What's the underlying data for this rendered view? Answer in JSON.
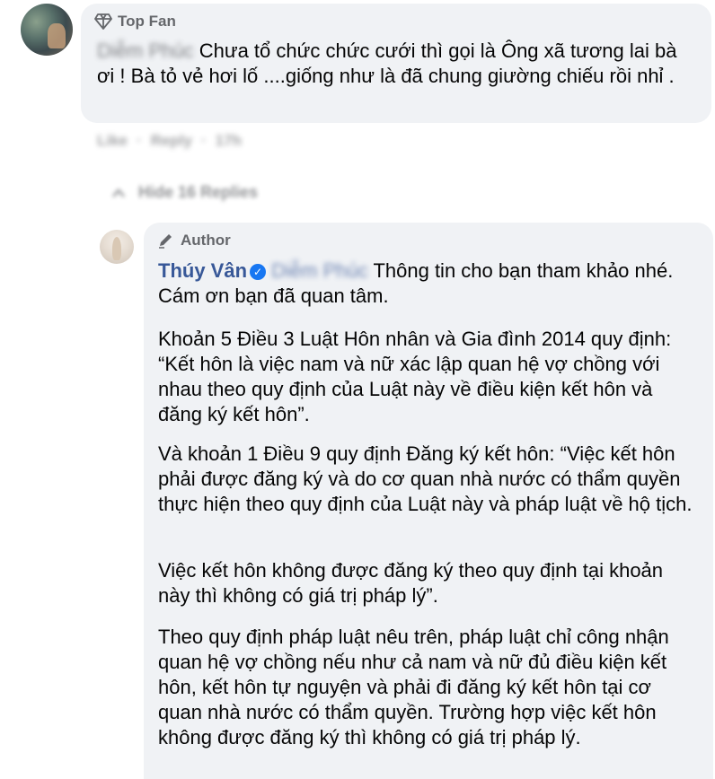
{
  "top_comment": {
    "badge": "Top Fan",
    "author_blurred": "Diễm Phúc",
    "text": "Chưa tổ chức chức cưới thì gọi là Ông xã tương lai bà ơi ! Bà tỏ vẻ hơi lố ....giống như là đã chung giường chiếu rồi nhỉ .",
    "actions": {
      "like": "Like",
      "reply": "Reply",
      "time": "17h"
    }
  },
  "hide_replies": {
    "label": "Hide 16 Replies"
  },
  "reply": {
    "badge": "Author",
    "author_name": "Thúy Vân",
    "mention_blurred": "Diễm Phúc",
    "intro": "Thông tin cho bạn tham khảo nhé. Cám ơn bạn đã quan tâm.",
    "paragraphs": [
      "Khoản 5 Điều 3 Luật Hôn nhân và Gia đình 2014 quy định: “Kết hôn là việc nam và nữ xác lập quan hệ vợ chồng với nhau theo quy định của Luật này về điều kiện kết hôn và đăng ký kết hôn”.",
      "Và khoản 1 Điều 9 quy định Đăng ký kết hôn: “Việc kết hôn phải được đăng ký và do cơ quan nhà nước có thẩm quyền thực hiện theo quy định của Luật này và pháp luật về hộ tịch.",
      "Việc kết hôn không được đăng ký theo quy định tại khoản này thì không có giá trị pháp lý”.",
      "Theo quy định pháp luật nêu trên, pháp luật chỉ công nhận quan hệ vợ chồng nếu như cả nam và nữ đủ điều kiện kết hôn, kết hôn tự nguyện và phải đi đăng ký kết hôn tại cơ quan nhà nước có thẩm quyền. Trường hợp việc kết hôn không được đăng ký thì không có giá trị pháp lý."
    ]
  },
  "icons": {
    "top_fan": "diamond-icon",
    "author": "pen-icon",
    "verified": "verified-check-icon",
    "hide": "chevron-up-icon"
  },
  "colors": {
    "bubble": "#f0f2f5",
    "name": "#385898",
    "meta": "#65676b",
    "verified": "#1877f2"
  }
}
